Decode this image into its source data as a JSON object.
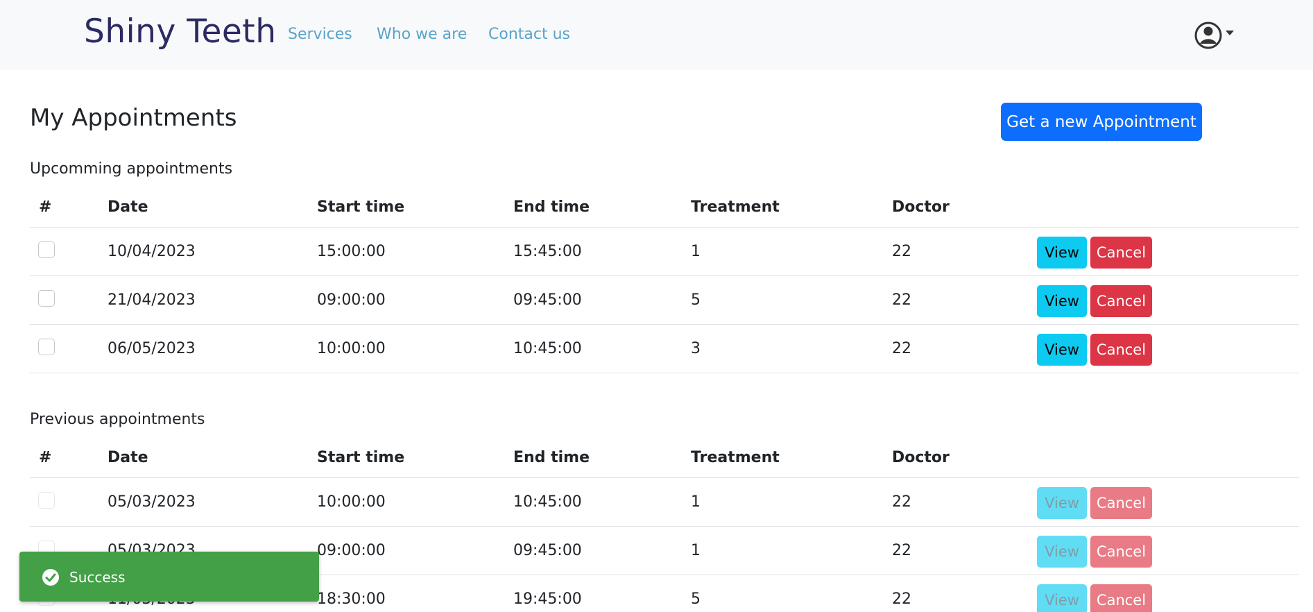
{
  "nav": {
    "brand": "Shiny Teeth",
    "links": [
      "Services",
      "Who we are",
      "Contact us"
    ],
    "user_icon": "user-circle-icon"
  },
  "page": {
    "title": "My Appointments",
    "new_button": "Get a new Appointment"
  },
  "columns": [
    "#",
    "Date",
    "Start time",
    "End time",
    "Treatment",
    "Doctor"
  ],
  "upcoming": {
    "title": "Upcomming appointments",
    "rows": [
      {
        "date": "10/04/2023",
        "start": "15:00:00",
        "end": "15:45:00",
        "treatment": "1",
        "doctor": "22"
      },
      {
        "date": "21/04/2023",
        "start": "09:00:00",
        "end": "09:45:00",
        "treatment": "5",
        "doctor": "22"
      },
      {
        "date": "06/05/2023",
        "start": "10:00:00",
        "end": "10:45:00",
        "treatment": "3",
        "doctor": "22"
      }
    ]
  },
  "previous": {
    "title": "Previous appointments",
    "rows": [
      {
        "date": "05/03/2023",
        "start": "10:00:00",
        "end": "10:45:00",
        "treatment": "1",
        "doctor": "22"
      },
      {
        "date": "05/03/2023",
        "start": "09:00:00",
        "end": "09:45:00",
        "treatment": "1",
        "doctor": "22"
      },
      {
        "date": "11/03/2023",
        "start": "18:30:00",
        "end": "19:45:00",
        "treatment": "5",
        "doctor": "22"
      }
    ]
  },
  "actions": {
    "view": "View",
    "cancel": "Cancel"
  },
  "toast": {
    "text": "Success",
    "icon": "check-circle-icon"
  },
  "colors": {
    "primary": "#0d6efd",
    "info": "#0dcaf0",
    "danger": "#dc3545",
    "success": "#43a047",
    "brand": "#2b2a63"
  }
}
